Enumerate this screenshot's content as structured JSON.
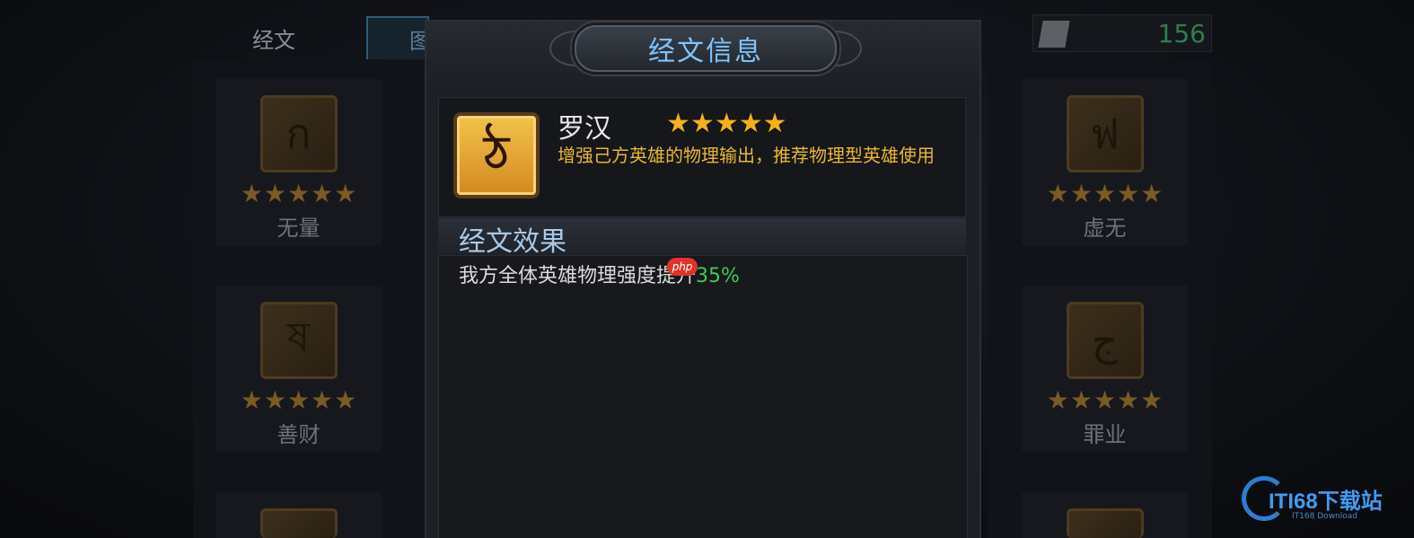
{
  "top_bar": {
    "tab_scripture": "经文",
    "tab_second": "图",
    "currency_value": "156"
  },
  "left_column": [
    {
      "name": "无量",
      "stars": 5
    },
    {
      "name": "善财",
      "stars": 5
    }
  ],
  "right_column": [
    {
      "name": "虚无",
      "stars": 5
    },
    {
      "name": "罪业",
      "stars": 5
    }
  ],
  "modal": {
    "title": "经文信息",
    "item_name": "罗汉",
    "item_stars": 5,
    "description": "增强己方英雄的物理输出，推荐物理型英雄使用",
    "effect_title": "经文效果",
    "effect_text": "我方全体英雄物理强度提升",
    "effect_value": "35%"
  },
  "overlay": {
    "php_badge": "php",
    "watermark_text": "ITI68下载站",
    "watermark_sub": "IT168 Download"
  },
  "colors": {
    "accent_blue": "#7fc3ff",
    "star_gold": "#f5b01e",
    "desc_gold": "#e9b733",
    "effect_green": "#3ec75a"
  }
}
